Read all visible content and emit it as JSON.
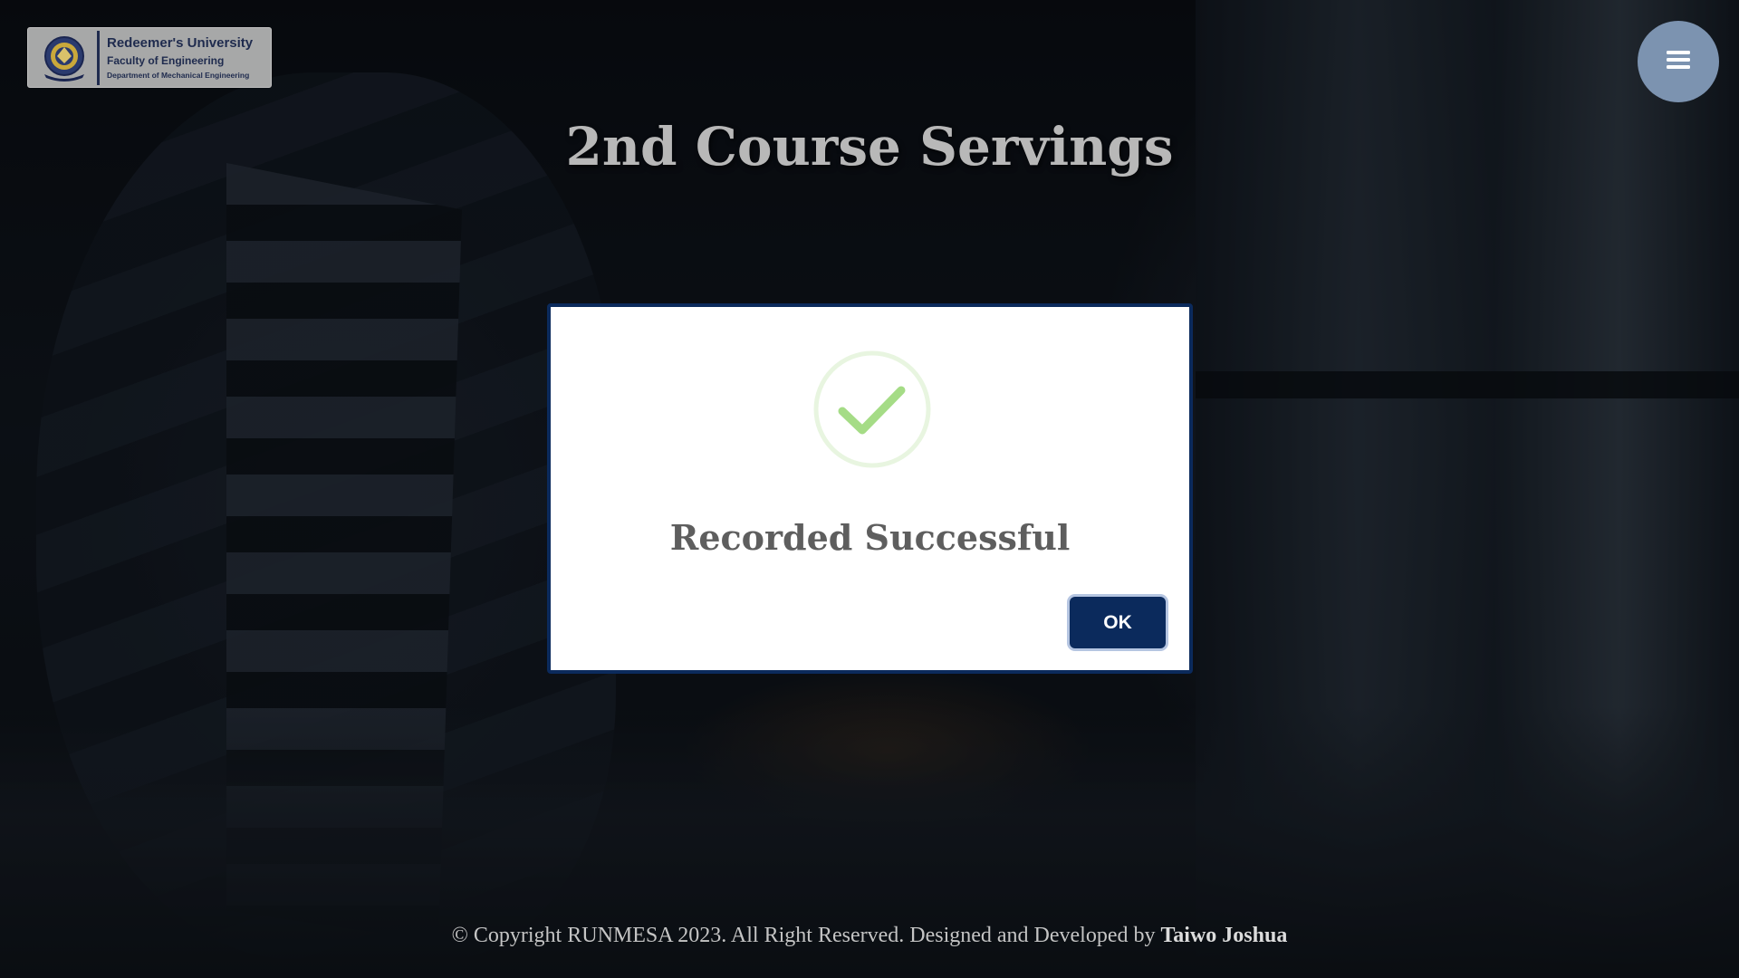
{
  "logo": {
    "university": "Redeemer's University",
    "faculty": "Faculty of Engineering",
    "department": "Department of Mechanical Engineering",
    "icon": "university-crest"
  },
  "menu_button": {
    "icon": "hamburger-menu-icon",
    "color": "#7c93b0"
  },
  "page": {
    "title": "2nd Course Servings"
  },
  "modal": {
    "icon": "success-check-icon",
    "message": "Recorded Successful",
    "ok_label": "OK",
    "accent": "#0b2a5c",
    "check_color": "#a5dc86"
  },
  "footer": {
    "text": "© Copyright RUNMESA 2023. All Right Reserved. Designed and Developed by",
    "author": "Taiwo Joshua"
  }
}
